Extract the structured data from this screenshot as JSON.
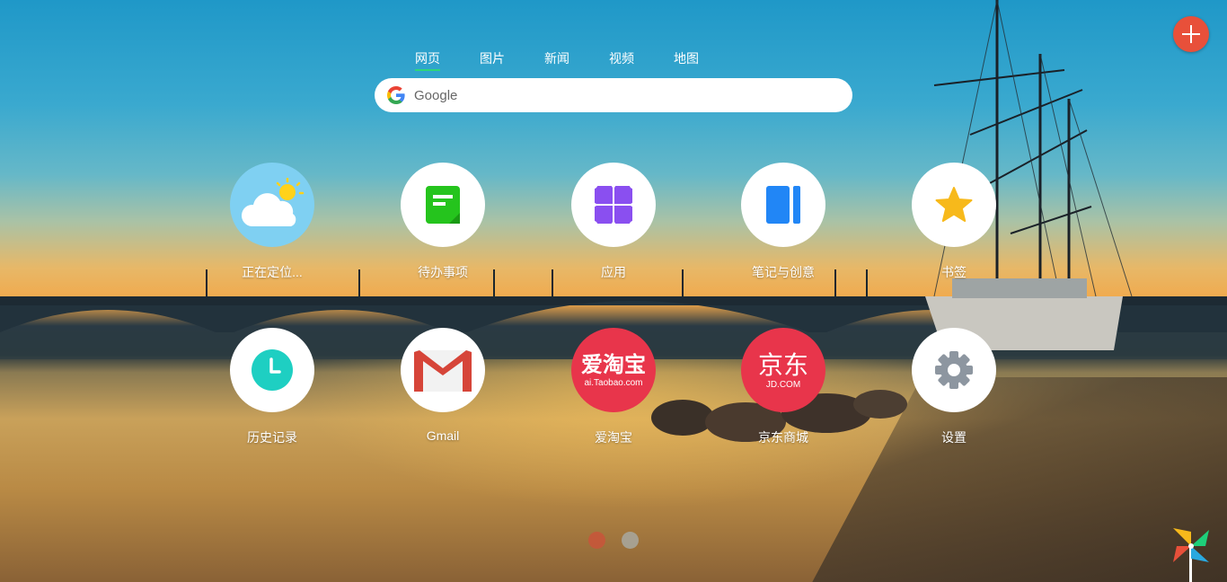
{
  "search": {
    "tabs": [
      {
        "label": "网页",
        "active": true
      },
      {
        "label": "图片",
        "active": false
      },
      {
        "label": "新闻",
        "active": false
      },
      {
        "label": "视频",
        "active": false
      },
      {
        "label": "地图",
        "active": false
      }
    ],
    "placeholder": "Google",
    "engine_icon": "google-g-icon"
  },
  "apps": {
    "weather": {
      "label": "正在定位...",
      "icon": "weather-cloud-sun-icon",
      "color": "#7fd0f2"
    },
    "todo": {
      "label": "待办事项",
      "icon": "todo-note-icon",
      "color": "#25c41d"
    },
    "apps": {
      "label": "应用",
      "icon": "apps-grid-icon",
      "color": "#8a4ff0"
    },
    "notes": {
      "label": "笔记与创意",
      "icon": "notebook-icon",
      "color": "#2186f6"
    },
    "bookmarks": {
      "label": "书签",
      "icon": "star-icon",
      "color": "#f7b91b"
    },
    "history": {
      "label": "历史记录",
      "icon": "clock-icon",
      "color": "#1ecfc2"
    },
    "gmail": {
      "label": "Gmail",
      "icon": "gmail-icon",
      "color": "#d64539"
    },
    "taobao": {
      "label": "爱淘宝",
      "logo_main": "爱淘宝",
      "logo_sub": "ai.Taobao.com",
      "color": "#e8354b"
    },
    "jd": {
      "label": "京东商城",
      "logo_main": "京东",
      "logo_sub": "JD.COM",
      "color": "#e8354b"
    },
    "settings": {
      "label": "设置",
      "icon": "gear-icon",
      "color": "#8d96a0"
    }
  },
  "add_button": {
    "icon": "plus-icon",
    "color": "#e8503a"
  },
  "pagination": {
    "current_page": 1,
    "total_pages": 2,
    "active_color": "#c9553a",
    "inactive_color": "#a8a8a0"
  },
  "corner_icon": "pinwheel-icon"
}
